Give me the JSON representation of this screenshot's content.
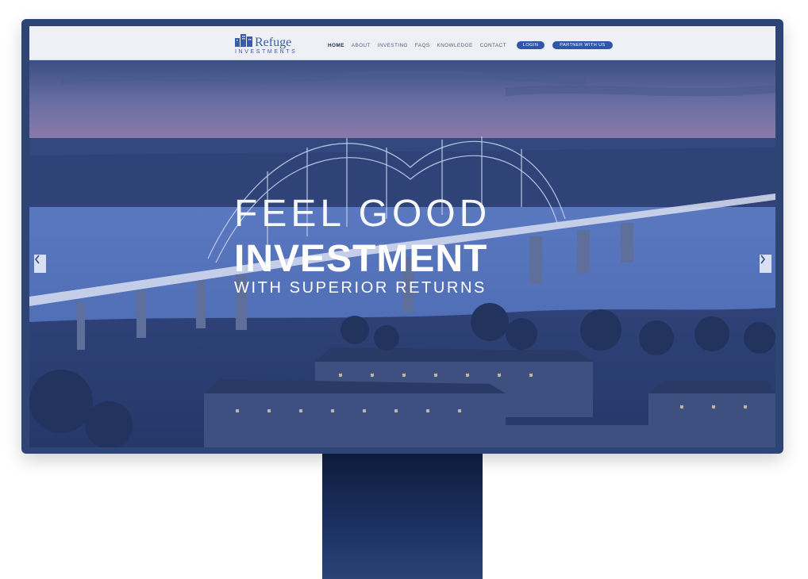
{
  "logo": {
    "name": "Refuge",
    "sub": "INVESTMENTS"
  },
  "nav": {
    "links": [
      "HOME",
      "ABOUT",
      "INVESTING",
      "FAQS",
      "KNOWLEDGE",
      "CONTACT"
    ],
    "login_label": "LOGIN",
    "partner_label": "PARTNER WITH US"
  },
  "hero": {
    "line1": "FEEL GOOD",
    "line2": "INVESTMENT",
    "line3": "WITH SUPERIOR RETURNS"
  },
  "icons": {
    "prev": "chevron-left-icon",
    "next": "chevron-right-icon",
    "logo": "buildings-logo-icon"
  },
  "colors": {
    "frame": "#2e4474",
    "brand": "#3a5ba8",
    "button": "#2f57a8",
    "stand": "#1d3264"
  }
}
